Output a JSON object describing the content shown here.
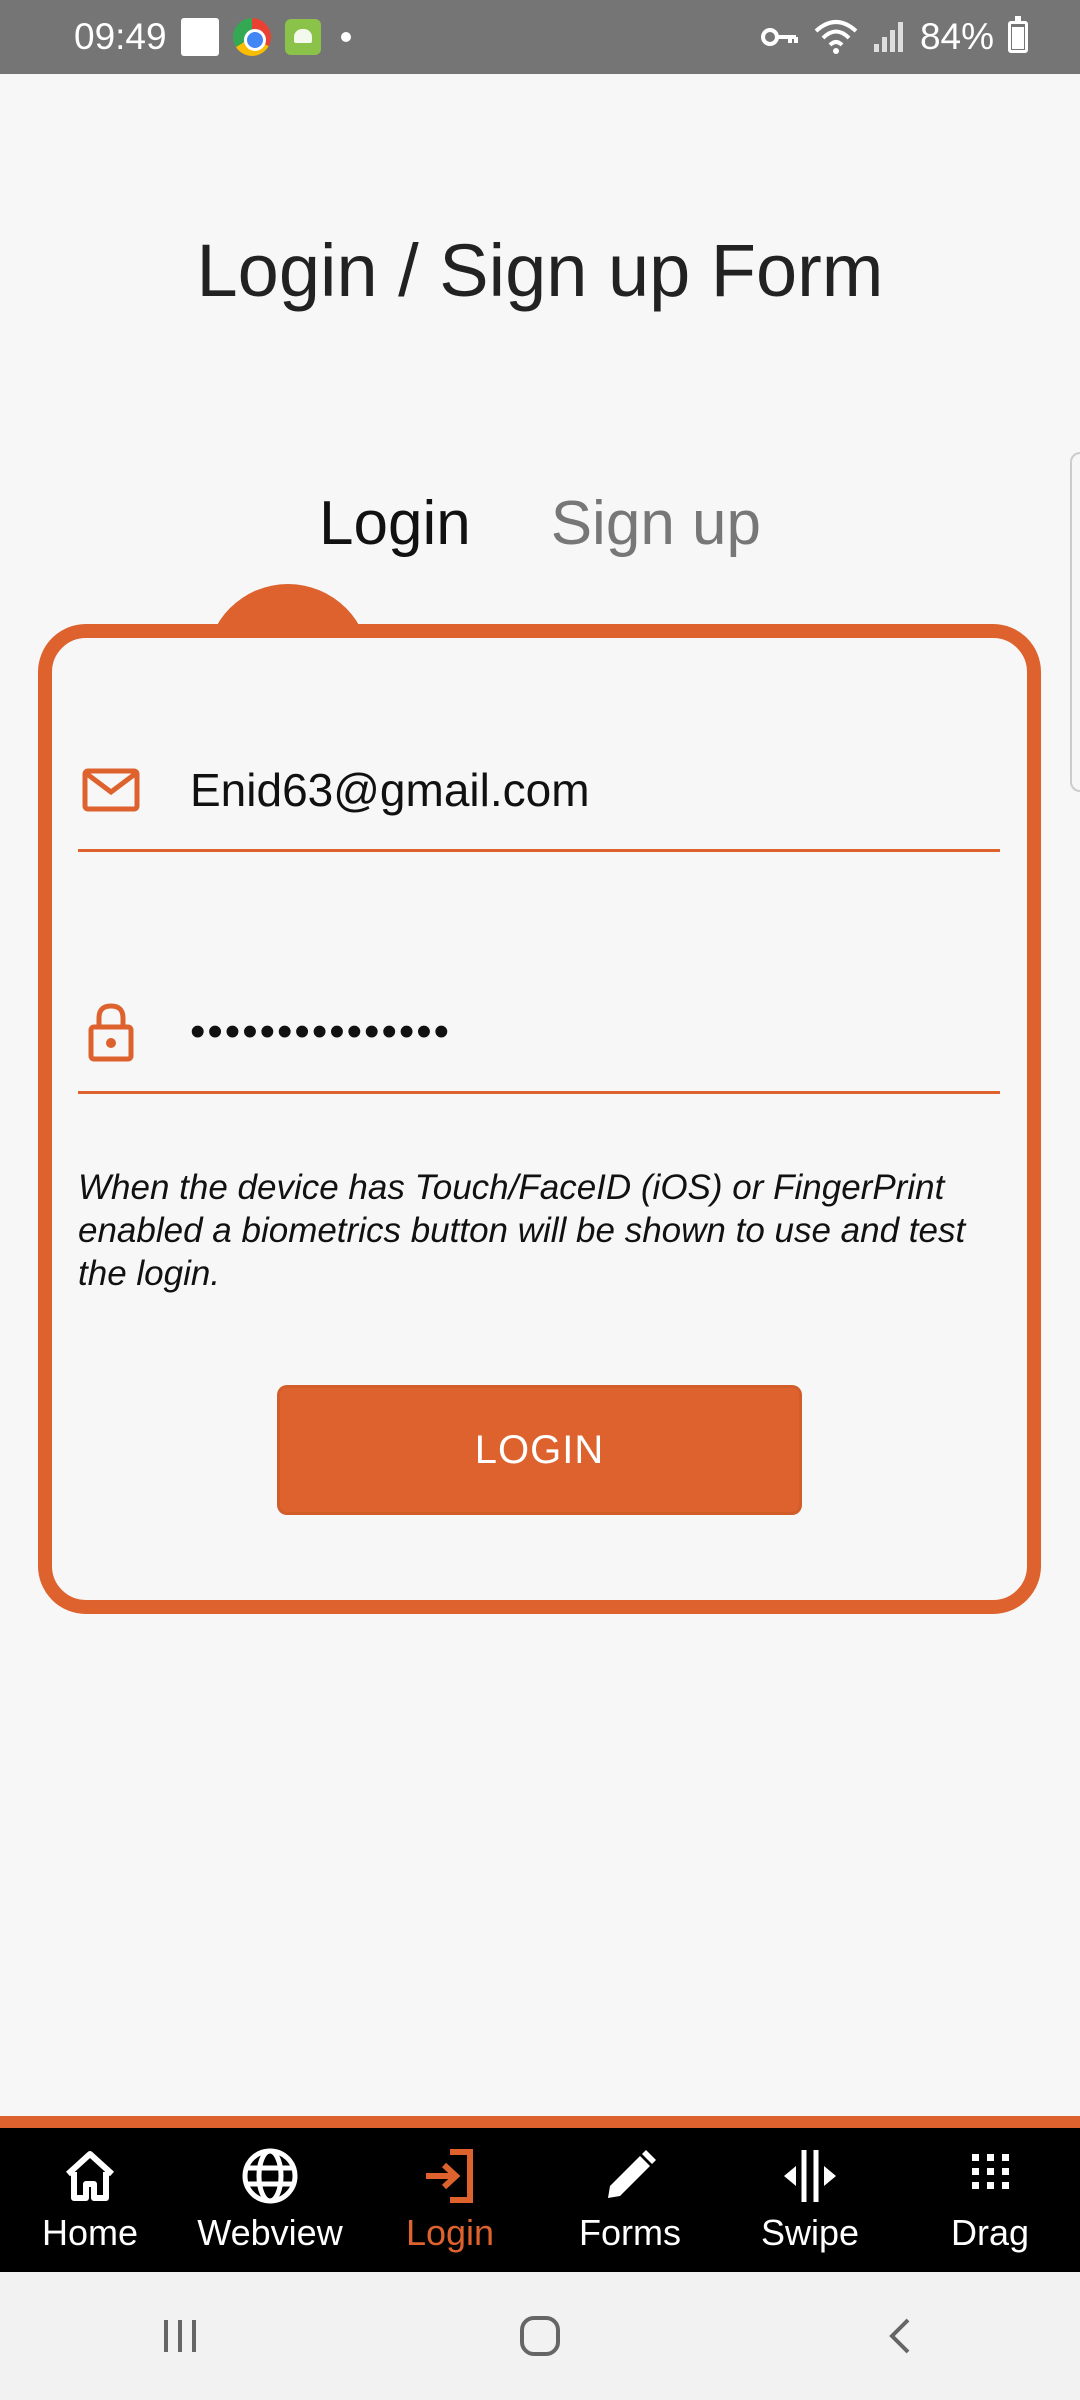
{
  "status_bar": {
    "time": "09:49",
    "battery": "84%"
  },
  "title": "Login / Sign up Form",
  "tabs": [
    {
      "label": "Login",
      "active": true
    },
    {
      "label": "Sign up",
      "active": false
    }
  ],
  "form": {
    "email_value": "Enid63@gmail.com",
    "password_value": "•••••••••••••••",
    "info_text": "When the device has Touch/FaceID (iOS) or FingerPrint enabled a biometrics button will be shown to use and test the login.",
    "login_label": "LOGIN"
  },
  "bottom_nav": [
    {
      "label": "Home",
      "icon": "home-icon",
      "active": false
    },
    {
      "label": "Webview",
      "icon": "globe-icon",
      "active": false
    },
    {
      "label": "Login",
      "icon": "login-icon",
      "active": true
    },
    {
      "label": "Forms",
      "icon": "pencil-icon",
      "active": false
    },
    {
      "label": "Swipe",
      "icon": "swipe-icon",
      "active": false
    },
    {
      "label": "Drag",
      "icon": "drag-icon",
      "active": false
    }
  ],
  "colors": {
    "accent": "#dd622d",
    "nav_background": "#000000",
    "status_bar": "#757575"
  }
}
